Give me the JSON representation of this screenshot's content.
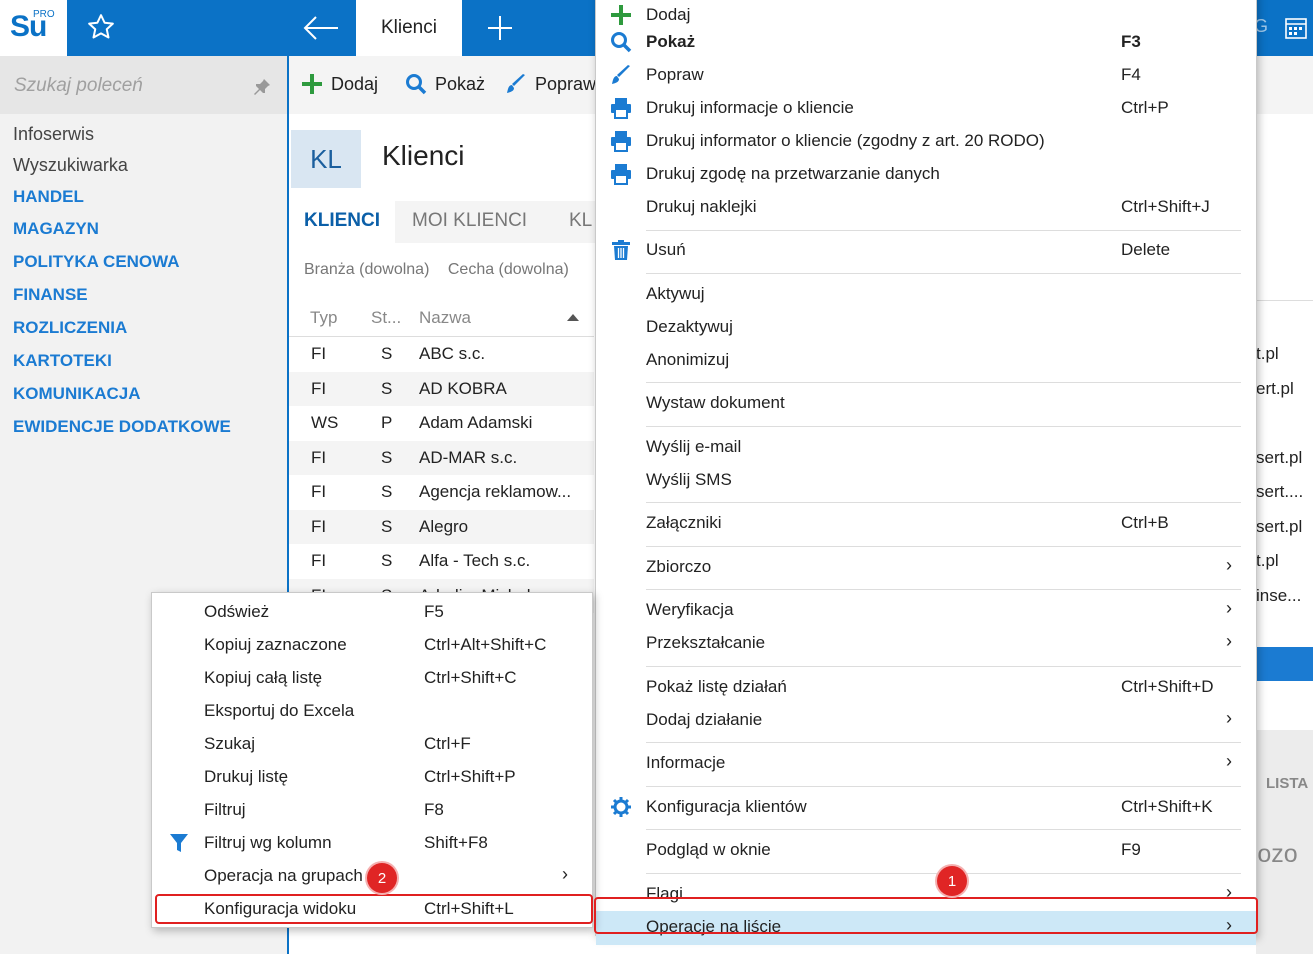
{
  "app": {
    "logo_text": "Su",
    "logo_pro": "PRO"
  },
  "topbar": {
    "active_tab": "Klienci",
    "right_fragment": "G"
  },
  "sidebar": {
    "search_placeholder": "Szukaj poleceń",
    "items": [
      {
        "label": "Infoserwis",
        "type": "plain"
      },
      {
        "label": "Wyszukiwarka",
        "type": "plain"
      },
      {
        "label": "HANDEL",
        "type": "section"
      },
      {
        "label": "MAGAZYN",
        "type": "section"
      },
      {
        "label": "POLITYKA CENOWA",
        "type": "section"
      },
      {
        "label": "FINANSE",
        "type": "section"
      },
      {
        "label": "ROZLICZENIA",
        "type": "section"
      },
      {
        "label": "KARTOTEKI",
        "type": "section"
      },
      {
        "label": "KOMUNIKACJA",
        "type": "section"
      },
      {
        "label": "EWIDENCJE DODATKOWE",
        "type": "section"
      }
    ]
  },
  "toolbar": {
    "add": "Dodaj",
    "show": "Pokaż",
    "edit": "Popraw"
  },
  "page": {
    "badge": "KL",
    "title": "Klienci",
    "tabs": [
      "KLIENCI",
      "MOI KLIENCI",
      "KL"
    ],
    "filter_branch": "Branża (dowolna)",
    "filter_feature": "Cecha (dowolna)"
  },
  "table": {
    "headers": {
      "type": "Typ",
      "status": "St...",
      "name": "Nazwa"
    },
    "rows": [
      {
        "type": "FI",
        "status": "S",
        "name": "ABC s.c.",
        "right": "t.pl"
      },
      {
        "type": "FI",
        "status": "S",
        "name": "AD KOBRA",
        "right": "ert.pl"
      },
      {
        "type": "WS",
        "status": "P",
        "name": "Adam Adamski",
        "right": ""
      },
      {
        "type": "FI",
        "status": "S",
        "name": "AD-MAR s.c.",
        "right": "sert.pl"
      },
      {
        "type": "FI",
        "status": "S",
        "name": "Agencja reklamow...",
        "right": "sert...."
      },
      {
        "type": "FI",
        "status": "S",
        "name": "Alegro",
        "right": "sert.pl"
      },
      {
        "type": "FI",
        "status": "S",
        "name": "Alfa - Tech s.c.",
        "right": "t.pl"
      },
      {
        "type": "FI",
        "status": "S",
        "name": "Adadi... Michal..",
        "right": "inse..."
      }
    ],
    "right_lista": "LISTA",
    "right_rozo": "rozo"
  },
  "main_menu": {
    "items": [
      {
        "label": "Dodaj",
        "shortcut": "",
        "icon": "plus-icon"
      },
      {
        "label": "Pokaż",
        "shortcut": "F3",
        "icon": "search-icon",
        "bold": true
      },
      {
        "label": "Popraw",
        "shortcut": "F4",
        "icon": "brush-icon"
      },
      {
        "label": "Drukuj informacje o kliencie",
        "shortcut": "Ctrl+P",
        "icon": "printer-icon"
      },
      {
        "label": "Drukuj informator o kliencie (zgodny z art. 20 RODO)",
        "shortcut": "",
        "icon": "printer-icon"
      },
      {
        "label": "Drukuj zgodę na przetwarzanie danych",
        "shortcut": "",
        "icon": "printer-icon"
      },
      {
        "label": "Drukuj naklejki",
        "shortcut": "Ctrl+Shift+J",
        "icon": ""
      },
      {
        "label": "Usuń",
        "shortcut": "Delete",
        "icon": "trash-icon"
      },
      {
        "label": "Aktywuj",
        "shortcut": "",
        "icon": ""
      },
      {
        "label": "Dezaktywuj",
        "shortcut": "",
        "icon": ""
      },
      {
        "label": "Anonimizuj",
        "shortcut": "",
        "icon": ""
      },
      {
        "label": "Wystaw dokument",
        "shortcut": "",
        "icon": ""
      },
      {
        "label": "Wyślij e-mail",
        "shortcut": "",
        "icon": ""
      },
      {
        "label": "Wyślij SMS",
        "shortcut": "",
        "icon": ""
      },
      {
        "label": "Załączniki",
        "shortcut": "Ctrl+B",
        "icon": ""
      },
      {
        "label": "Zbiorczo",
        "shortcut": "",
        "icon": "",
        "submenu": true
      },
      {
        "label": "Weryfikacja",
        "shortcut": "",
        "icon": "",
        "submenu": true
      },
      {
        "label": "Przekształcanie",
        "shortcut": "",
        "icon": "",
        "submenu": true
      },
      {
        "label": "Pokaż listę działań",
        "shortcut": "Ctrl+Shift+D",
        "icon": ""
      },
      {
        "label": "Dodaj działanie",
        "shortcut": "",
        "icon": "",
        "submenu": true
      },
      {
        "label": "Informacje",
        "shortcut": "",
        "icon": "",
        "submenu": true
      },
      {
        "label": "Konfiguracja klientów",
        "shortcut": "Ctrl+Shift+K",
        "icon": "gear-icon"
      },
      {
        "label": "Podgląd w oknie",
        "shortcut": "F9",
        "icon": ""
      },
      {
        "label": "Flagi",
        "shortcut": "",
        "icon": "",
        "submenu": true
      },
      {
        "label": "Operacje na liście",
        "shortcut": "",
        "icon": "",
        "submenu": true,
        "highlighted": true
      }
    ],
    "arrow": "›"
  },
  "sub_menu": {
    "items": [
      {
        "label": "Odśwież",
        "shortcut": "F5"
      },
      {
        "label": "Kopiuj zaznaczone",
        "shortcut": "Ctrl+Alt+Shift+C"
      },
      {
        "label": "Kopiuj całą listę",
        "shortcut": "Ctrl+Shift+C"
      },
      {
        "label": "Eksportuj do Excela",
        "shortcut": ""
      },
      {
        "label": "Szukaj",
        "shortcut": "Ctrl+F"
      },
      {
        "label": "Drukuj listę",
        "shortcut": "Ctrl+Shift+P"
      },
      {
        "label": "Filtruj",
        "shortcut": "F8"
      },
      {
        "label": "Filtruj wg kolumn",
        "shortcut": "Shift+F8",
        "icon": "funnel-icon"
      },
      {
        "label": "Operacja na grupach",
        "shortcut": "",
        "submenu": true
      },
      {
        "label": "Konfiguracja widoku",
        "shortcut": "Ctrl+Shift+L"
      }
    ]
  },
  "annotations": {
    "badge1": "1",
    "badge2": "2"
  },
  "colors": {
    "brand": "#0b72c6",
    "section": "#1b7bd2",
    "highlight": "#cde8f7",
    "annotation": "#e02020"
  }
}
